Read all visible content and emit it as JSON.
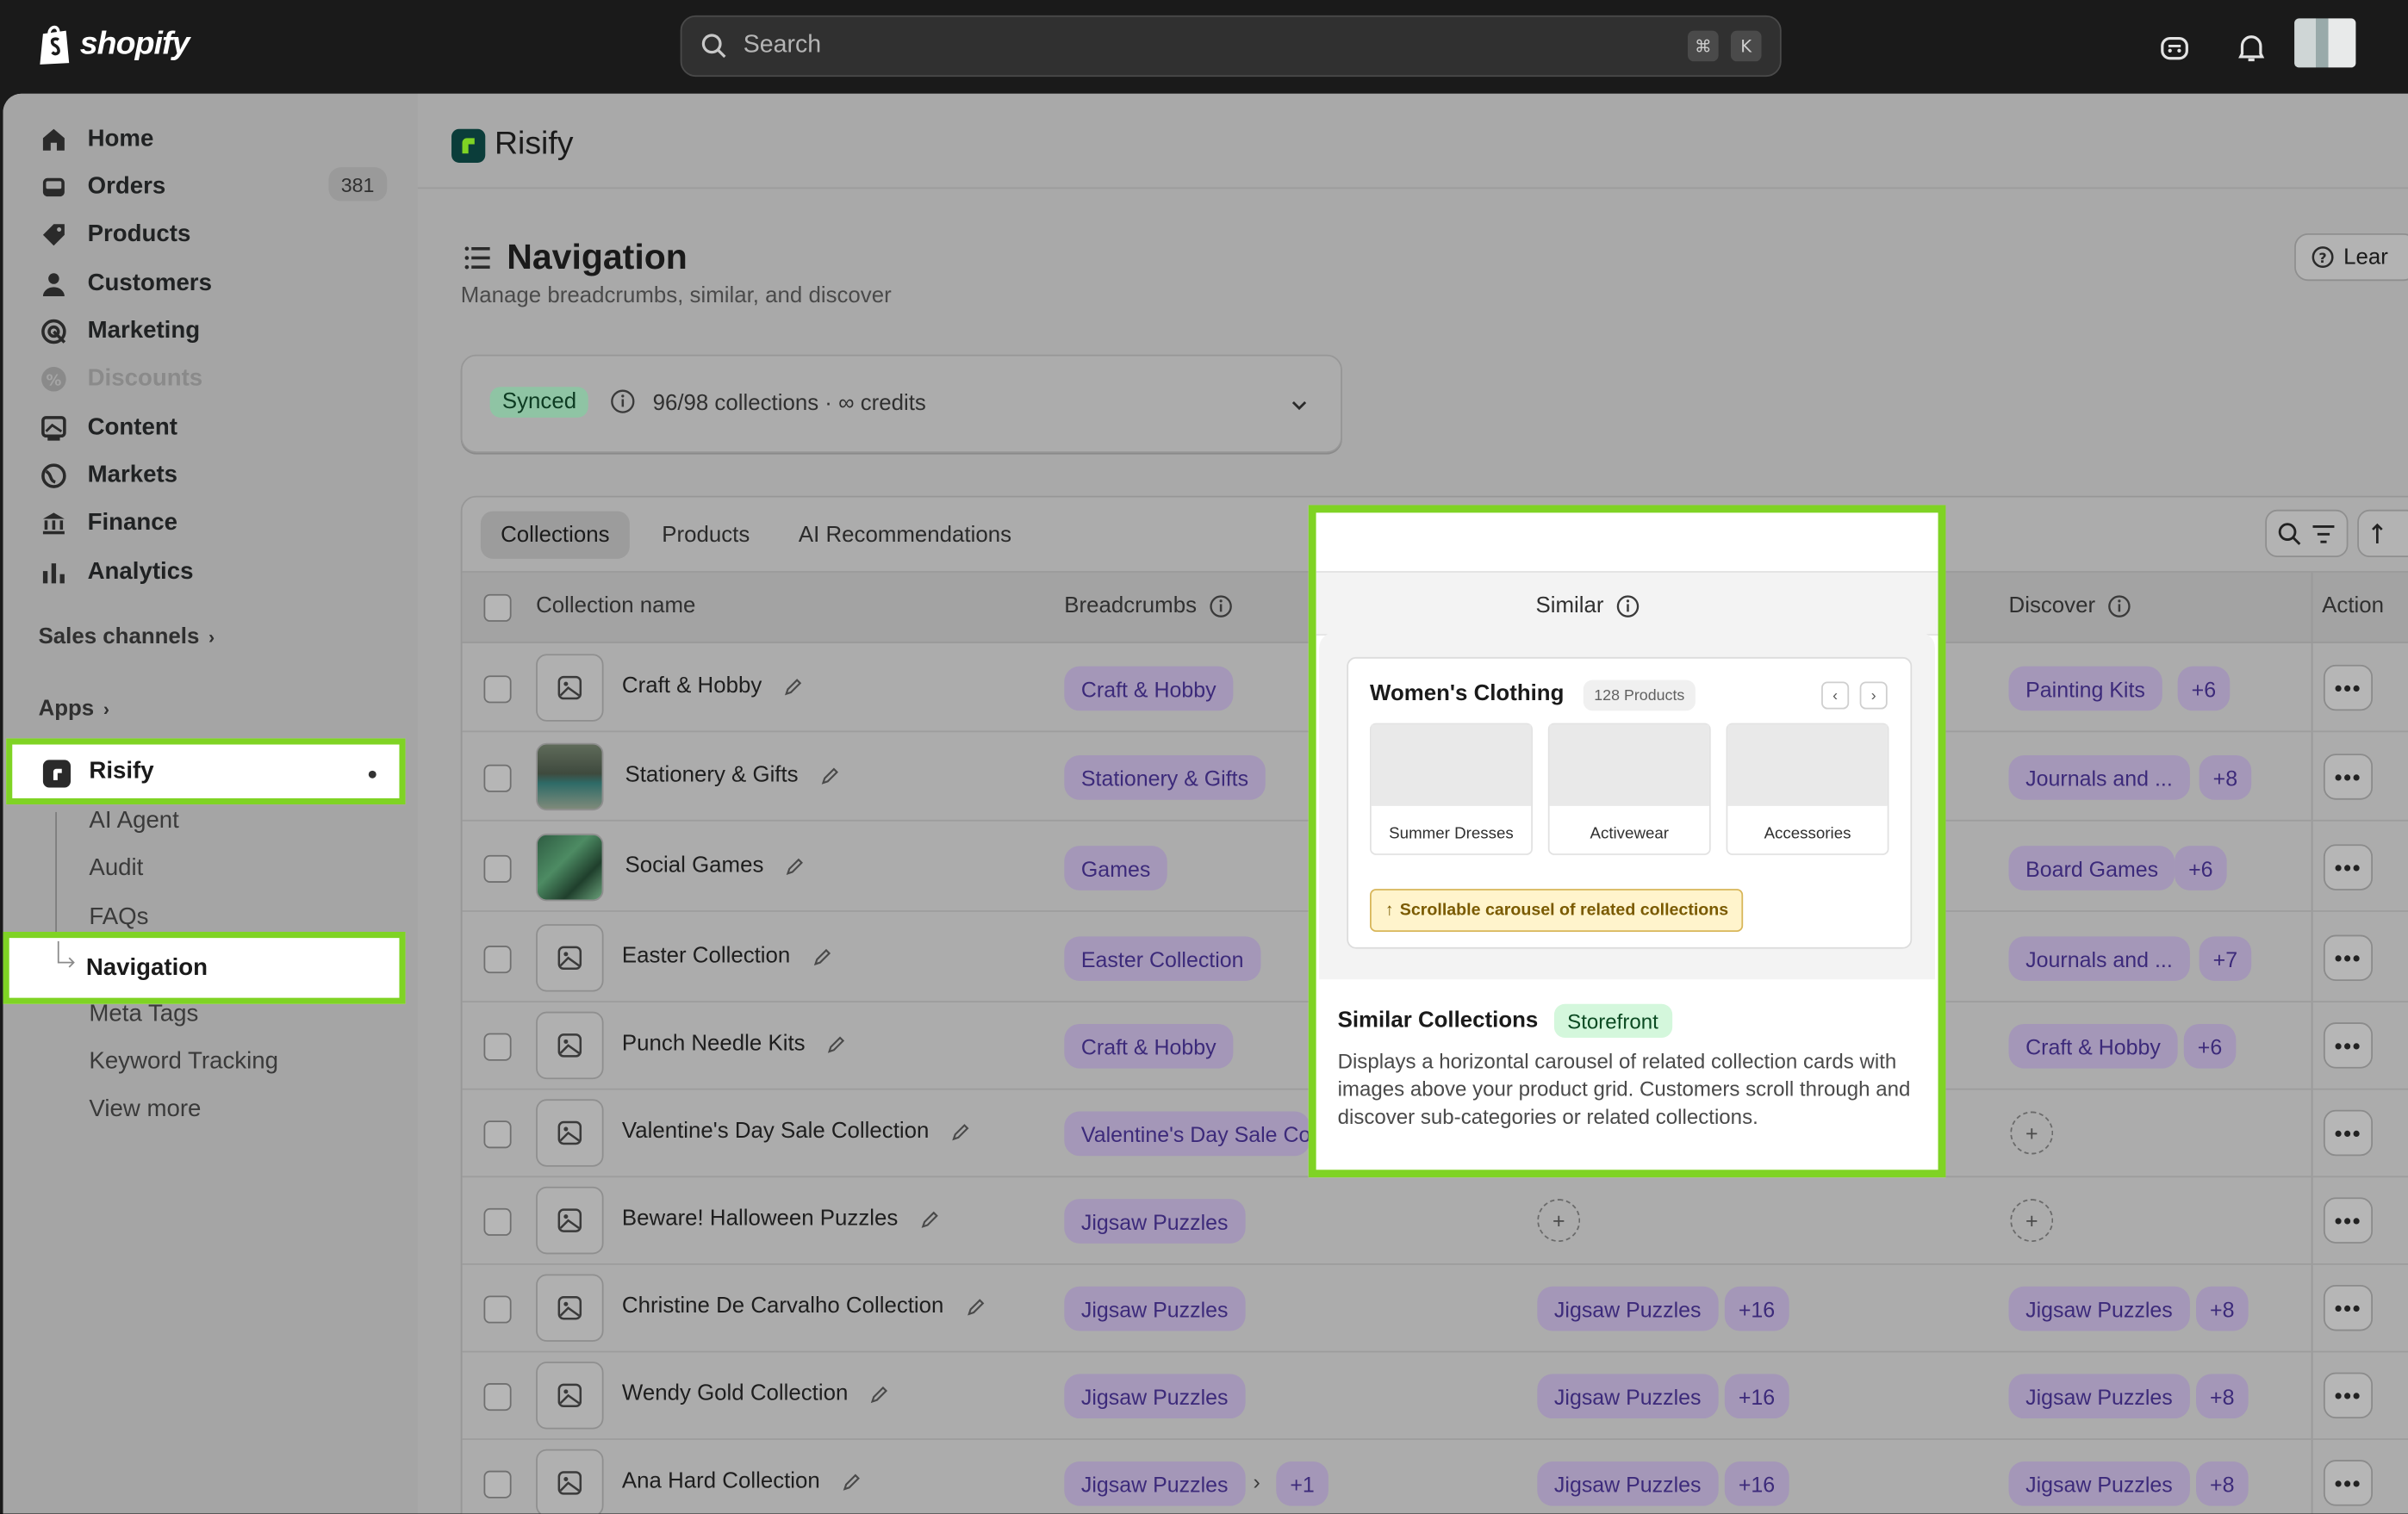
{
  "topbar": {
    "brand": "shopify",
    "search_placeholder": "Search",
    "shortcut_keys": [
      "⌘",
      "K"
    ]
  },
  "sidebar": {
    "items": [
      {
        "label": "Home",
        "icon": "home-icon"
      },
      {
        "label": "Orders",
        "icon": "orders-icon",
        "count": "381"
      },
      {
        "label": "Products",
        "icon": "tag-icon"
      },
      {
        "label": "Customers",
        "icon": "person-icon"
      },
      {
        "label": "Marketing",
        "icon": "target-icon"
      },
      {
        "label": "Discounts",
        "icon": "discount-icon",
        "disabled": true
      },
      {
        "label": "Content",
        "icon": "content-icon"
      },
      {
        "label": "Markets",
        "icon": "globe-icon"
      },
      {
        "label": "Finance",
        "icon": "bank-icon"
      },
      {
        "label": "Analytics",
        "icon": "bar-chart-icon"
      }
    ],
    "sales_channels": "Sales channels",
    "apps": "Apps",
    "app_name": "Risify",
    "app_subitems": [
      "AI Agent",
      "Audit",
      "FAQs",
      "Navigation",
      "Meta Tags",
      "Keyword Tracking",
      "View more"
    ]
  },
  "app": {
    "name": "Risify"
  },
  "page": {
    "title": "Navigation",
    "subtitle": "Manage breadcrumbs, similar, and discover",
    "learn_label": "Lear"
  },
  "sync": {
    "status": "Synced",
    "text": "96/98 collections · ∞ credits"
  },
  "tabs": [
    "Collections",
    "Products",
    "AI Recommendations"
  ],
  "table": {
    "headers": {
      "name": "Collection name",
      "breadcrumbs": "Breadcrumbs",
      "similar": "Similar",
      "discover": "Discover",
      "actions": "Action"
    },
    "rows": [
      {
        "name": "Craft & Hobby",
        "breadcrumb": "Craft & Hobby",
        "similar": "",
        "similar_more": "",
        "discover": "Painting Kits",
        "discover_more": "+6",
        "thumb": "placeholder"
      },
      {
        "name": "Stationery & Gifts",
        "breadcrumb": "Stationery & Gifts",
        "similar": "",
        "similar_more": "",
        "discover": "Journals and ...",
        "discover_more": "+8",
        "thumb": "photo-person"
      },
      {
        "name": "Social Games",
        "breadcrumb": "Games",
        "similar": "",
        "similar_more": "",
        "discover": "Board Games",
        "discover_more": "+6",
        "thumb": "photo-green"
      },
      {
        "name": "Easter Collection",
        "breadcrumb": "Easter Collection",
        "similar": "",
        "similar_more": "",
        "discover": "Journals and ...",
        "discover_more": "+7",
        "thumb": "placeholder"
      },
      {
        "name": "Punch Needle Kits",
        "breadcrumb": "Craft & Hobby",
        "similar": "",
        "similar_more": "",
        "discover": "Craft & Hobby",
        "discover_more": "+6",
        "thumb": "placeholder"
      },
      {
        "name": "Valentine's Day Sale Collection",
        "breadcrumb": "Valentine's Day Sale Col",
        "similar": "",
        "similar_more": "",
        "discover": "",
        "discover_more": "",
        "thumb": "placeholder"
      },
      {
        "name": "Beware! Halloween Puzzles",
        "breadcrumb": "Jigsaw Puzzles",
        "similar": "",
        "similar_more": "",
        "discover": "",
        "discover_more": "",
        "thumb": "placeholder"
      },
      {
        "name": "Christine De Carvalho Collection",
        "breadcrumb": "Jigsaw Puzzles",
        "similar": "Jigsaw Puzzles",
        "similar_more": "+16",
        "discover": "Jigsaw Puzzles",
        "discover_more": "+8",
        "thumb": "placeholder"
      },
      {
        "name": "Wendy Gold Collection",
        "breadcrumb": "Jigsaw Puzzles",
        "similar": "Jigsaw Puzzles",
        "similar_more": "+16",
        "discover": "Jigsaw Puzzles",
        "discover_more": "+8",
        "thumb": "placeholder"
      },
      {
        "name": "Ana Hard Collection",
        "breadcrumb": "Jigsaw Puzzles",
        "breadcrumb_more": "+1",
        "similar": "Jigsaw Puzzles",
        "similar_more": "+16",
        "discover": "Jigsaw Puzzles",
        "discover_more": "+8",
        "thumb": "placeholder"
      }
    ]
  },
  "popover": {
    "header": "Similar",
    "preview": {
      "title": "Women's Clothing",
      "badge": "128 Products",
      "tiles": [
        "Summer Dresses",
        "Activewear",
        "Accessories"
      ],
      "note": "Scrollable carousel of related collections"
    },
    "title": "Similar Collections",
    "tag": "Storefront",
    "description": "Displays a horizontal carousel of related collection cards with images above your product grid. Customers scroll through and discover sub-categories or related collections."
  },
  "colors": {
    "highlight": "#7fd324",
    "pill_bg": "#a497b8",
    "pill_text": "#3c2a7a",
    "synced": "#8fc4a4"
  }
}
